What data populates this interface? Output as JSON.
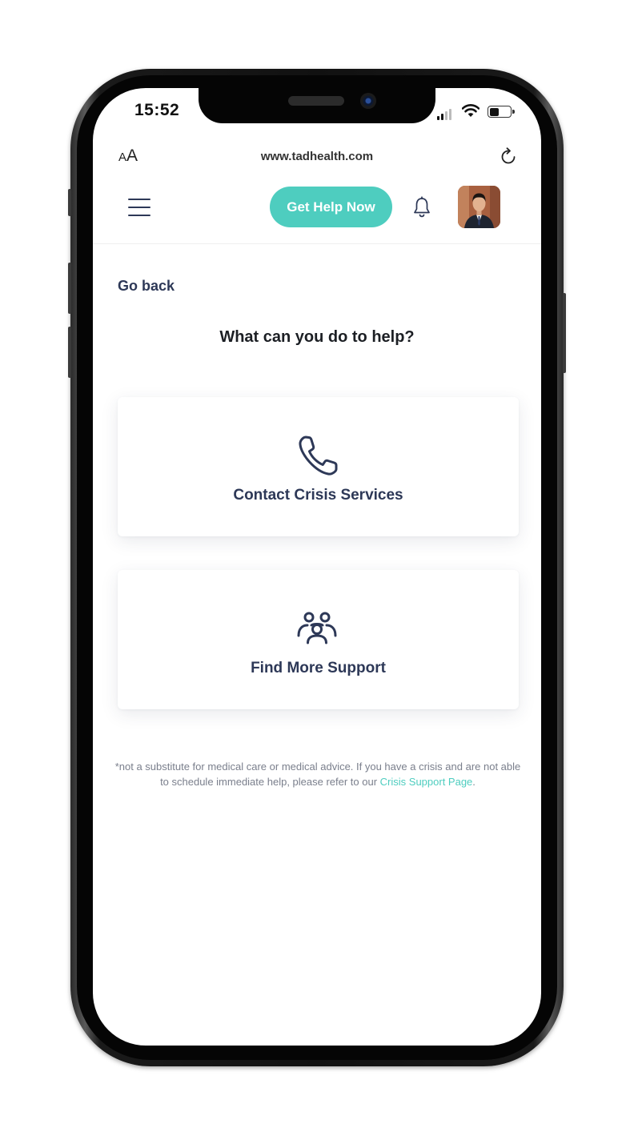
{
  "status_bar": {
    "time": "15:52"
  },
  "browser": {
    "text_size_label_small": "A",
    "text_size_label_large": "A",
    "url": "www.tadhealth.com",
    "reload_icon": "reload-icon"
  },
  "header": {
    "menu_icon": "hamburger-menu-icon",
    "help_button_label": "Get Help Now",
    "bell_icon": "notification-bell-icon",
    "accent_color": "#4ecdbf"
  },
  "content": {
    "go_back_label": "Go back",
    "title": "What can you do to help?",
    "options": [
      {
        "icon": "phone-icon",
        "label": "Contact Crisis Services"
      },
      {
        "icon": "group-icon",
        "label": "Find More Support"
      }
    ],
    "disclaimer_text": "*not a substitute for medical care or medical advice. If you have a crisis and are not able to schedule immediate help, please refer to our ",
    "disclaimer_link": "Crisis Support Page",
    "disclaimer_end": "."
  },
  "colors": {
    "text_primary": "#2d3857",
    "heading": "#1c1f24",
    "muted": "#7a7f8c"
  }
}
